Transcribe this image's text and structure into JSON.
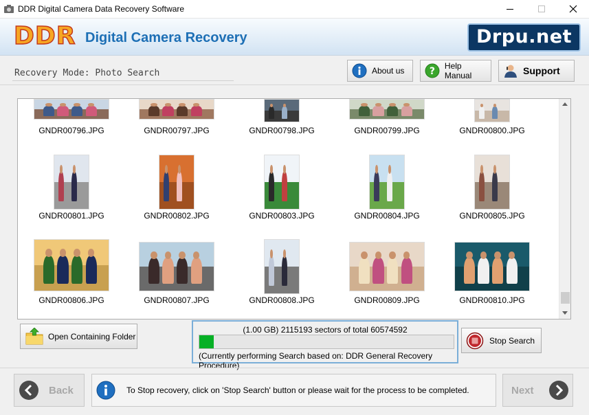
{
  "window": {
    "title": "DDR Digital Camera Data Recovery Software",
    "icon": "camera-app-icon"
  },
  "banner": {
    "logo": "DDR",
    "title": "Digital Camera Recovery",
    "brand": "Drpu.net"
  },
  "mode": {
    "label": "Recovery Mode: Photo Search"
  },
  "toolbar": {
    "about_label": "About us",
    "help_label": "Help Manual",
    "support_label": "Support"
  },
  "gallery": {
    "files": [
      "GNDR00796.JPG",
      "GNDR00797.JPG",
      "GNDR00798.JPG",
      "GNDR00799.JPG",
      "GNDR00800.JPG",
      "GNDR00801.JPG",
      "GNDR00802.JPG",
      "GNDR00803.JPG",
      "GNDR00804.JPG",
      "GNDR00805.JPG",
      "GNDR00806.JPG",
      "GNDR00807.JPG",
      "GNDR00808.JPG",
      "GNDR00809.JPG",
      "GNDR00810.JPG"
    ],
    "scroll_position": 0.97
  },
  "actions": {
    "open_folder_label": "Open Containing Folder",
    "stop_label": "Stop Search"
  },
  "progress": {
    "summary": "(1.00 GB) 2115193  sectors  of  total 60574592",
    "fraction": 0.0349,
    "status": "(Currently performing Search based on:  DDR General Recovery Procedure)"
  },
  "footer": {
    "back_label": "Back",
    "next_label": "Next",
    "info_text": "To Stop recovery, click on 'Stop Search' button or please wait for the process to be completed."
  },
  "colors": {
    "accent": "#1d6fb5",
    "progress": "#06b025",
    "brand_bg": "#0c3763"
  }
}
